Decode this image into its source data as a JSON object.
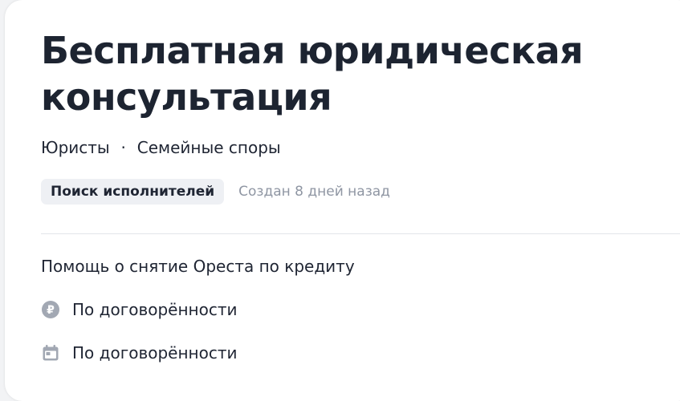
{
  "task": {
    "title": "Бесплатная юридическая консультация",
    "category": "Юристы",
    "subcategory": "Семейные споры",
    "status": "Поиск исполнителей",
    "created": "Создан 8 дней назад",
    "description": "Помощь о снятие Ореста по кредиту",
    "price": {
      "icon": "ruble-icon",
      "label": "По договорённости"
    },
    "date": {
      "icon": "calendar-icon",
      "label": "По договорённости"
    }
  },
  "colors": {
    "title_text": "#1d2431",
    "muted_text": "#8f96a3",
    "badge_bg": "#eef0f4",
    "icon_gray": "#a2a8b3",
    "divider": "#e3e5ea"
  }
}
